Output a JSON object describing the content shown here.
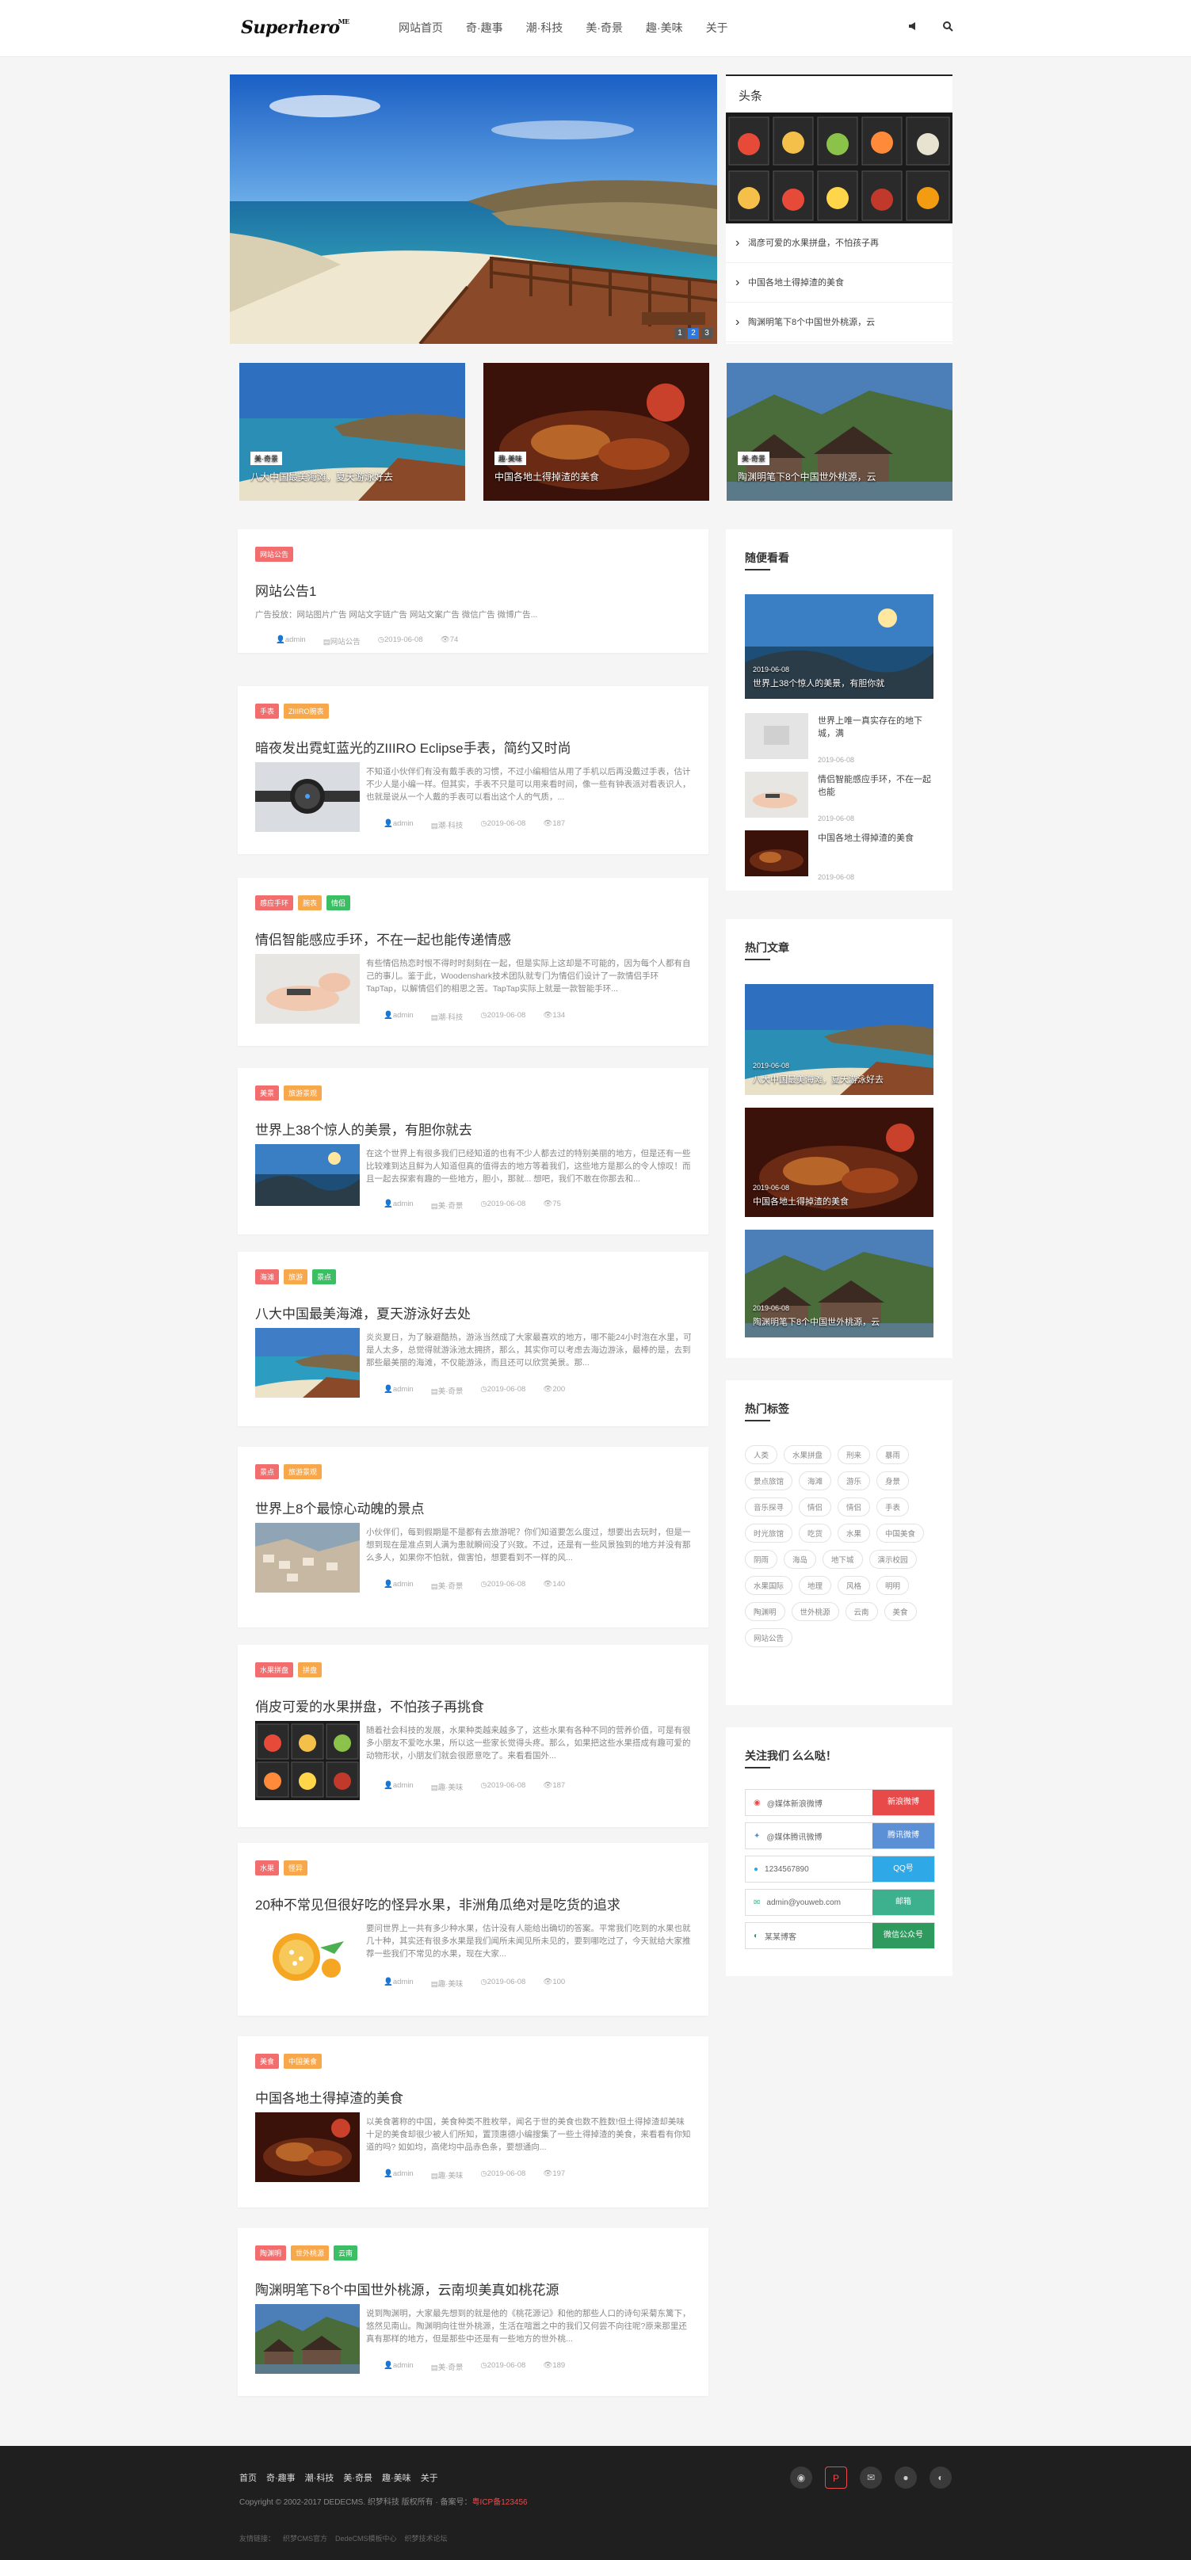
{
  "site": {
    "logo": "Superhero",
    "logo_sup": "ME"
  },
  "nav": {
    "items": [
      "网站首页",
      "奇·趣事",
      "潮·科技",
      "美·奇景",
      "趣·美味",
      "关于"
    ]
  },
  "slider": {
    "pages": [
      "1",
      "2",
      "3"
    ],
    "active": 1
  },
  "headline": {
    "title": "头条",
    "items": [
      "渴彦可爱的水果拼盘，不怕孩子再",
      "中国各地土得掉渣的美食",
      "陶渊明笔下8个中国世外桃源，云"
    ]
  },
  "featured": [
    {
      "tag": "美·奇景",
      "title": "八大中国最美海滩，夏天游泳好去"
    },
    {
      "tag": "趣·美味",
      "title": "中国各地土得掉渣的美食"
    },
    {
      "tag": "美·奇景",
      "title": "陶渊明笔下8个中国世外桃源，云"
    }
  ],
  "posts": [
    {
      "tags": [
        "网站公告"
      ],
      "title": "网站公告1",
      "desc": "广告投放：网站图片广告 网站文字链广告 网站文案广告 微信广告 微博广告...",
      "author": "admin",
      "category": "网站公告",
      "date": "2019-06-08",
      "views": "74"
    },
    {
      "tags": [
        "手表",
        "ZIIIRO腕表"
      ],
      "title": "暗夜发出霓虹蓝光的ZIIIRO Eclipse手表，简约又时尚",
      "desc": "不知道小伙伴们有没有戴手表的习惯，不过小编相信从用了手机以后再没戴过手表，估计不少人是小编一样。但其实，手表不只是可以用来看时间，像一些有钟表派对看表识人，也就是说从一个人戴的手表可以看出这个人的气质，...",
      "author": "admin",
      "category": "潮·科技",
      "date": "2019-06-08",
      "views": "187"
    },
    {
      "tags": [
        "感应手环",
        "腕表",
        "情侣"
      ],
      "title": "情侣智能感应手环，不在一起也能传递情感",
      "desc": "有些情侣热恋时恨不得时时刻刻在一起，但是实际上这却是不可能的，因为每个人都有自己的事儿。鉴于此，Woodenshark技术团队就专门为情侣们设计了一款情侣手环TapTap，以解情侣们的相思之苦。TapTap实际上就是一款智能手环...",
      "author": "admin",
      "category": "潮·科技",
      "date": "2019-06-08",
      "views": "134"
    },
    {
      "tags": [
        "美景",
        "旅游景观"
      ],
      "title": "世界上38个惊人的美景，有胆你就去",
      "desc": "在这个世界上有很多我们已经知道的也有不少人都去过的特别美丽的地方，但是还有一些比较难到达且鲜为人知道但真的值得去的地方等着我们，这些地方是那么的令人惊叹！而且一起去探索有趣的一些地方，胆小，那就... 想吧，我们不敢在你那去和...",
      "author": "admin",
      "category": "美·奇景",
      "date": "2019-06-08",
      "views": "75"
    },
    {
      "tags": [
        "海滩",
        "旅游",
        "景点"
      ],
      "title": "八大中国最美海滩，夏天游泳好去处",
      "desc": "炎炎夏日，为了躲避酷热，游泳当然成了大家最喜欢的地方，哪不能24小时泡在水里，可是人太多，总觉得就游泳池太拥挤，那么，其实你可以考虑去海边游泳，最棒的是，去到那些最美丽的海滩，不仅能游泳，而且还可以欣赏美景。那...",
      "author": "admin",
      "category": "美·奇景",
      "date": "2019-06-08",
      "views": "200"
    },
    {
      "tags": [
        "景点",
        "旅游景观"
      ],
      "title": "世界上8个最惊心动魄的景点",
      "desc": "小伙伴们，每到假期是不是都有去旅游呢？你们知道要怎么度过，想要出去玩时，但是一想到现在是准点到人满为患就瞬间没了兴致。不过，还是有一些风景独到的地方并没有那么多人，如果你不怕就，做害怕，想要看到不一样的风...",
      "author": "admin",
      "category": "美·奇景",
      "date": "2019-06-08",
      "views": "140"
    },
    {
      "tags": [
        "水果拼盘",
        "拼盘"
      ],
      "title": "俏皮可爱的水果拼盘，不怕孩子再挑食",
      "desc": "随着社会科技的发展，水果种类越来越多了，这些水果有各种不同的营养价值，可是有很多小朋友不爱吃水果，所以这一些家长觉得头疼。那么，如果把这些水果搭成有趣可爱的动物形状，小朋友们就会很愿意吃了。来看看国外...",
      "author": "admin",
      "category": "趣·美味",
      "date": "2019-06-08",
      "views": "187"
    },
    {
      "tags": [
        "水果",
        "怪异"
      ],
      "title": "20种不常见但很好吃的怪异水果，非洲角瓜绝对是吃货的追求",
      "desc": "要问世界上一共有多少种水果，估计没有人能给出确切的答案。平常我们吃到的水果也就几十种，其实还有很多水果是我们闻所未闻见所未见的，要到哪吃过了，今天就给大家推荐一些我们不常见的水果，现在大家...",
      "author": "admin",
      "category": "趣·美味",
      "date": "2019-06-08",
      "views": "100"
    },
    {
      "tags": [
        "美食",
        "中国美食"
      ],
      "title": "中国各地土得掉渣的美食",
      "desc": "以美食著称的中国，美食种类不胜枚举，闻名于世的美食也数不胜数!但土得掉渣却美味十足的美食却很少被人们所知，置顶惠德小编搜集了一些土得掉渣的美食，来看看有你知道的吗? 如如均，高佬均中品赤色条，要想通向...",
      "author": "admin",
      "category": "趣·美味",
      "date": "2019-06-08",
      "views": "197"
    },
    {
      "tags": [
        "陶渊明",
        "世外桃源",
        "云南"
      ],
      "title": "陶渊明笔下8个中国世外桃源，云南坝美真如桃花源",
      "desc": "说到陶渊明，大家最先想到的就是他的《桃花源记》和他的那些人口的诗句采菊东篱下，悠然见南山。陶渊明向往世外桃源，生活在喧嚣之中的我们又何尝不向往呢?原来那里还真有那样的地方，但是那些中还是有一些地方的世外桃...",
      "author": "admin",
      "category": "美·奇景",
      "date": "2019-06-08",
      "views": "189"
    }
  ],
  "random": {
    "title": "随便看看",
    "big": {
      "date": "2019-06-08",
      "title": "世界上38个惊人的美景，有胆你就"
    },
    "items": [
      {
        "title": "世界上唯一真实存在的地下城，满",
        "date": "2019-06-08"
      },
      {
        "title": "情侣智能感应手环，不在一起也能",
        "date": "2019-06-08"
      },
      {
        "title": "中国各地土得掉渣的美食",
        "date": "2019-06-08"
      }
    ]
  },
  "hot": {
    "title": "热门文章",
    "items": [
      {
        "date": "2019-06-08",
        "title": "八大中国最美海滩，夏天游泳好去"
      },
      {
        "date": "2019-06-08",
        "title": "中国各地土得掉渣的美食"
      },
      {
        "date": "2019-06-08",
        "title": "陶渊明笔下8个中国世外桃源，云"
      }
    ]
  },
  "tags": {
    "title": "热门标签",
    "items": [
      "人类",
      "水果拼盘",
      "刑来",
      "暴雨",
      "景点旅馆",
      "海滩",
      "游乐",
      "身景",
      "音乐探寻",
      "情侣",
      "情侣",
      "手表",
      "时光旅馆",
      "吃货",
      "水果",
      "中国美食",
      "阴雨",
      "海岛",
      "地下城",
      "演示校园",
      "水果国际",
      "地理",
      "风格",
      "明明",
      "陶渊明",
      "世外桃源",
      "云南",
      "美食",
      "网站公告"
    ]
  },
  "follow": {
    "title": "关注我们 么么哒！",
    "items": [
      {
        "label": "@媒体新浪微博",
        "button": "新浪微博",
        "color": "#e84a4a"
      },
      {
        "label": "@媒体腾讯微博",
        "button": "腾讯微博",
        "color": "#5b8fd6"
      },
      {
        "label": "1234567890",
        "button": "QQ号",
        "color": "#2fa8e8"
      },
      {
        "label": "admin@youweb.com",
        "button": "邮箱",
        "color": "#3db08e"
      },
      {
        "label": "某某博客",
        "button": "微信公众号",
        "color": "#2e9a5e"
      }
    ]
  },
  "footer": {
    "nav": [
      "首页",
      "奇·趣事",
      "潮·科技",
      "美·奇景",
      "趣·美味",
      "关于"
    ],
    "copyright": "Copyright © 2002-2017 DEDECMS. 织梦科技 版权所有 · 备案号：",
    "icp": "粤ICP备123456",
    "links": [
      "友情链接：",
      "织梦CMS官方",
      "DedeCMS模板中心",
      "织梦技术论坛"
    ]
  },
  "colors": {
    "accent": "#e84a4a",
    "tag_red": "#f26d6d",
    "tag_orange": "#f7a74c",
    "tag_green": "#3cbf64"
  }
}
